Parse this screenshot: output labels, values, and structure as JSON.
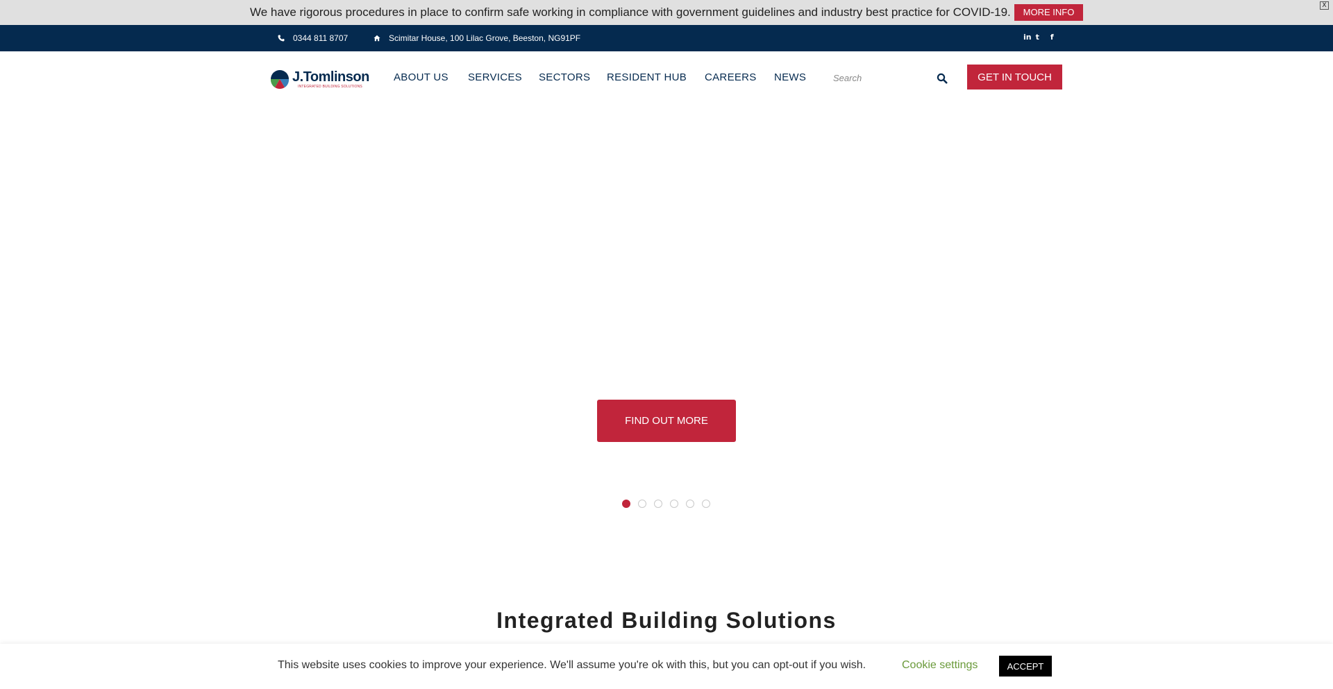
{
  "notice": {
    "text": "We have rigorous procedures in place to confirm safe working in compliance with government guidelines and industry best practice for COVID-19.",
    "more_info_label": "MORE INFO",
    "close_label": "X"
  },
  "topbar": {
    "phone": "0344 811 8707",
    "address": "Scimitar House, 100 Lilac Grove, Beeston, NG91PF",
    "social": [
      "in",
      "t",
      "f"
    ]
  },
  "header": {
    "logo_text": "J.Tomlinson",
    "logo_tagline": "INTEGRATED BUILDING SOLUTIONS",
    "nav": [
      "ABOUT US",
      "SERVICES",
      "SECTORS",
      "RESIDENT HUB",
      "CAREERS",
      "NEWS"
    ],
    "search_placeholder": "Search",
    "cta_label": "GET IN TOUCH"
  },
  "hero": {
    "button_label": "FIND OUT MORE",
    "slide_count": 6,
    "active_slide": 1
  },
  "section": {
    "title": "Integrated Building Solutions"
  },
  "cookie": {
    "text": "This website uses cookies to improve your experience. We'll assume you're ok with this, but you can opt-out if you wish.",
    "settings_label": "Cookie settings",
    "accept_label": "ACCEPT"
  },
  "colors": {
    "brand_red": "#c1253b",
    "brand_navy": "#052a4f",
    "notice_bg": "#e0e0e0"
  }
}
